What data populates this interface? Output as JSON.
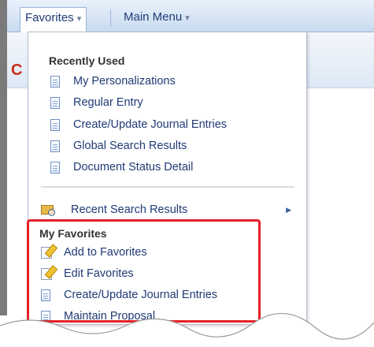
{
  "navbar": {
    "favorites_label": "Favorites",
    "main_menu_label": "Main Menu"
  },
  "page": {
    "title_fragment": "C"
  },
  "dropdown": {
    "recently_used": {
      "title": "Recently Used",
      "items": [
        {
          "label": "My Personalizations",
          "icon": "document-icon"
        },
        {
          "label": "Regular Entry",
          "icon": "document-icon"
        },
        {
          "label": "Create/Update Journal Entries",
          "icon": "document-icon"
        },
        {
          "label": "Global Search Results",
          "icon": "document-icon"
        },
        {
          "label": "Document Status Detail",
          "icon": "document-icon"
        }
      ]
    },
    "recent_search": {
      "label": "Recent Search Results",
      "icon": "folder-search-icon"
    },
    "my_favorites": {
      "title": "My Favorites",
      "items": [
        {
          "label": "Add to Favorites",
          "icon": "edit-favorites-icon"
        },
        {
          "label": "Edit Favorites",
          "icon": "edit-favorites-icon"
        },
        {
          "label": "Create/Update Journal Entries",
          "icon": "document-icon"
        },
        {
          "label": "Maintain Proposal",
          "icon": "document-icon"
        }
      ]
    }
  },
  "colors": {
    "link": "#1f3a75",
    "highlight": "#e32228",
    "navbar": "#c9dbf0"
  }
}
